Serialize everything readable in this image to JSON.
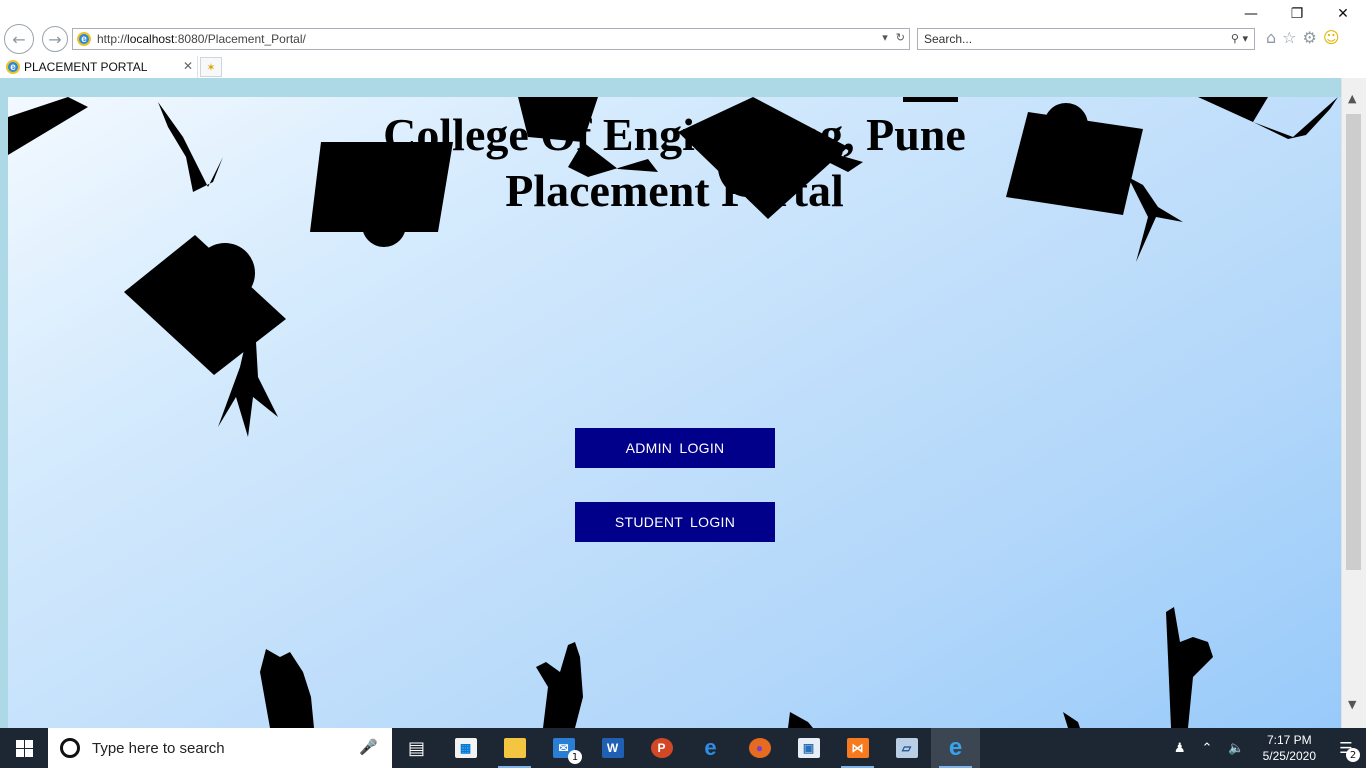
{
  "browser": {
    "url_prefix": "http://",
    "url_host": "localhost",
    "url_rest": ":8080/Placement_Portal/",
    "search_placeholder": "Search...",
    "tab_title": "PLACEMENT PORTAL"
  },
  "page": {
    "heading_line1": "College Of Engineering, Pune",
    "heading_line2": "Placement Portal",
    "admin_login_label": "ADMIN  LOGIN",
    "student_login_label": "STUDENT  LOGIN",
    "background_color": "#add8e6",
    "button_color": "#00008b"
  },
  "taskbar": {
    "search_placeholder": "Type here to search",
    "mail_badge": "1",
    "time": "7:17 PM",
    "date": "5/25/2020",
    "notification_count": "2",
    "apps": [
      "task-view",
      "store",
      "file-explorer",
      "mail",
      "word",
      "powerpoint",
      "edge",
      "firefox",
      "app-window",
      "xampp",
      "virtualbox",
      "internet-explorer"
    ]
  }
}
